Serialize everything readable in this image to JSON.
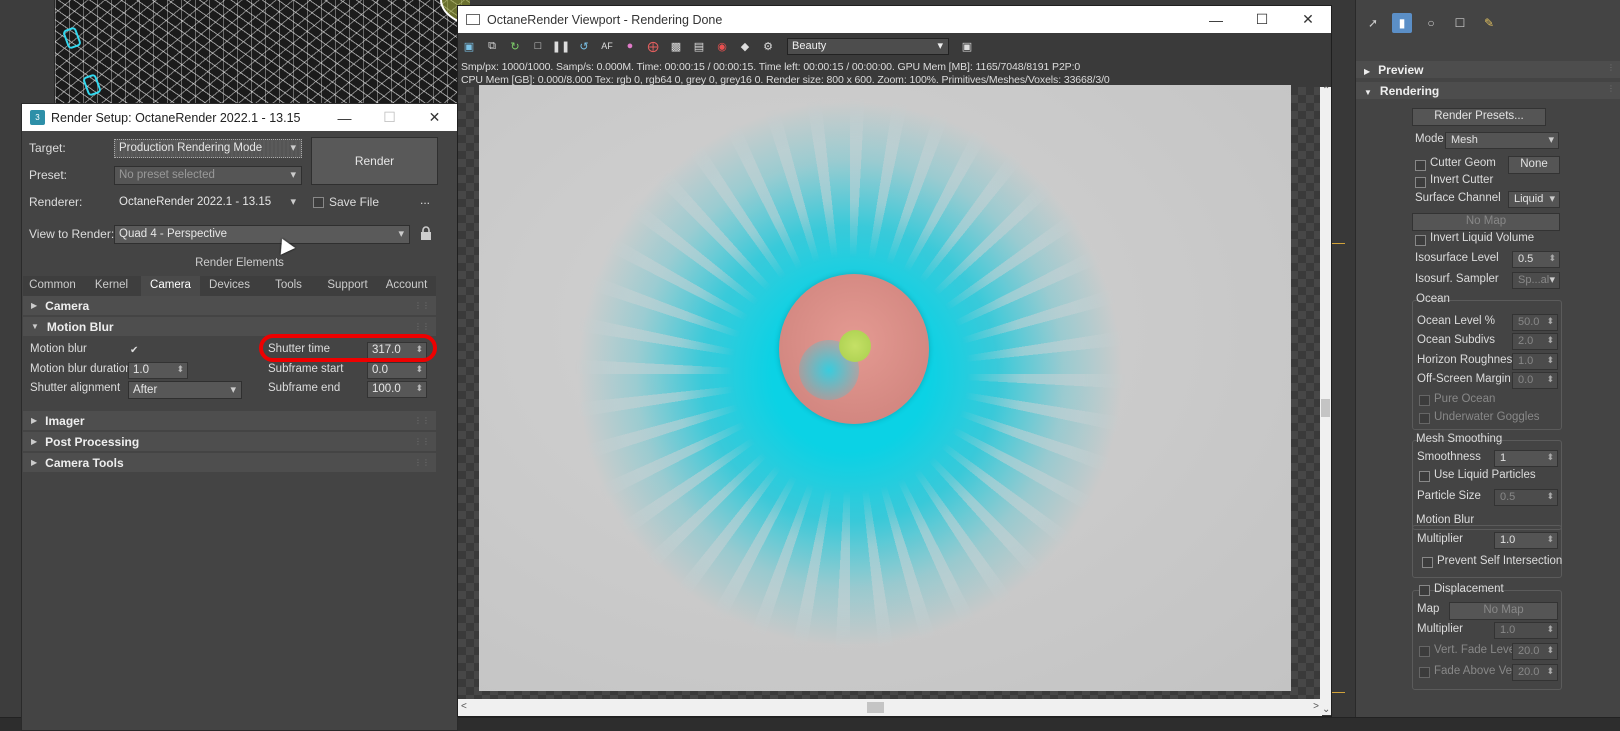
{
  "render_setup": {
    "title": "Render Setup: OctaneRender 2022.1 - 13.15",
    "app_icon_text": "3",
    "labels": {
      "target": "Target:",
      "preset": "Preset:",
      "renderer": "Renderer:",
      "view": "View to Render:"
    },
    "target_value": "Production Rendering Mode",
    "preset_value": "No preset selected",
    "renderer_value": "OctaneRender 2022.1 - 13.15",
    "view_value": "Quad 4 - Perspective",
    "render_button": "Render",
    "save_file_label": "Save File",
    "more_button": "...",
    "render_elements_label": "Render Elements",
    "tabs": [
      "Common",
      "Kernel",
      "Camera",
      "Devices",
      "Tools",
      "Support",
      "Account"
    ],
    "active_tab": "Camera",
    "rollouts": {
      "camera": "Camera",
      "motion_blur": "Motion Blur",
      "imager": "Imager",
      "post_processing": "Post Processing",
      "camera_tools": "Camera Tools"
    },
    "motion_blur": {
      "motion_blur_label": "Motion blur",
      "motion_blur_checked": true,
      "duration_label": "Motion blur duration",
      "duration_value": "1.0",
      "alignment_label": "Shutter alignment",
      "alignment_value": "After",
      "shutter_time_label": "Shutter time",
      "shutter_time_value": "317.0",
      "subframe_start_label": "Subframe start",
      "subframe_start_value": "0.0",
      "subframe_end_label": "Subframe end",
      "subframe_end_value": "100.0"
    }
  },
  "octane_viewport": {
    "title": "OctaneRender Viewport - Rendering Done",
    "pass_select": "Beauty",
    "status_line1": "Smp/px: 1000/1000.   Samp/s: 0.000M.   Time: 00:00:15 / 00:00:15.   Time left: 00:00:15 / 00:00:00.   GPU Mem [MB]: 1165/7048/8191 P2P:0",
    "status_line2": "CPU Mem [GB]: 0.000/8.000   Tex: rgb 0, rgb64 0, grey 0, grey16 0.   Render size: 800 x 600.   Zoom: 100%.   Primitives/Meshes/Voxels: 33668/3/0",
    "toolbar_icons": [
      "save-icon",
      "copy-icon",
      "refresh-icon",
      "lock-icon",
      "pause-icon",
      "restart-icon",
      "af-icon",
      "color-wheel-icon",
      "region-icon",
      "display-icon",
      "film-icon",
      "record-icon",
      "camera-icon",
      "settings-gear-icon"
    ]
  },
  "command_panel": {
    "preview_label": "Preview",
    "rendering_label": "Rendering",
    "render_presets_button": "Render Presets...",
    "mode_label": "Mode",
    "mode_value": "Mesh",
    "cutter_geom_label": "Cutter Geom",
    "cutter_geom_value": "None",
    "invert_cutter_label": "Invert Cutter",
    "surface_channel_label": "Surface Channel",
    "surface_channel_value": "Liquid",
    "no_map_1": "No Map",
    "invert_liquid_volume_label": "Invert Liquid Volume",
    "isosurface_level_label": "Isosurface Level",
    "isosurface_level_value": "0.5",
    "isosurf_sampler_label": "Isosurf. Sampler",
    "isosurf_sampler_value": "Sp...al",
    "ocean": {
      "title": "Ocean",
      "level_label": "Ocean Level %",
      "level_value": "50.0",
      "subdivs_label": "Ocean Subdivs",
      "subdivs_value": "2.0",
      "horizon_label": "Horizon Roughness",
      "horizon_value": "1.0",
      "offscreen_label": "Off-Screen Margin",
      "offscreen_value": "0.0",
      "pure_ocean_label": "Pure Ocean",
      "underwater_label": "Underwater Goggles"
    },
    "mesh_smoothing": {
      "title": "Mesh Smoothing",
      "smoothness_label": "Smoothness",
      "smoothness_value": "1",
      "use_liquid_label": "Use Liquid Particles",
      "particle_size_label": "Particle Size",
      "particle_size_value": "0.5"
    },
    "motion_blur": {
      "title": "Motion Blur",
      "multiplier_label": "Multiplier",
      "multiplier_value": "1.0",
      "prevent_label": "Prevent Self Intersection"
    },
    "displacement": {
      "title": "Displacement",
      "map_label": "Map",
      "map_value": "No Map",
      "multiplier_label": "Multiplier",
      "multiplier_value": "1.0",
      "vert_fade_label": "Vert. Fade Level",
      "vert_fade_value": "20.0",
      "fade_above_label": "Fade Above Vel",
      "fade_above_value": "20.0"
    }
  },
  "colors": {
    "accent_ring": "#e00000",
    "cyan_fluid": "#00d2e6",
    "core_sphere": "#d88a84",
    "panel_bg": "#444444"
  }
}
